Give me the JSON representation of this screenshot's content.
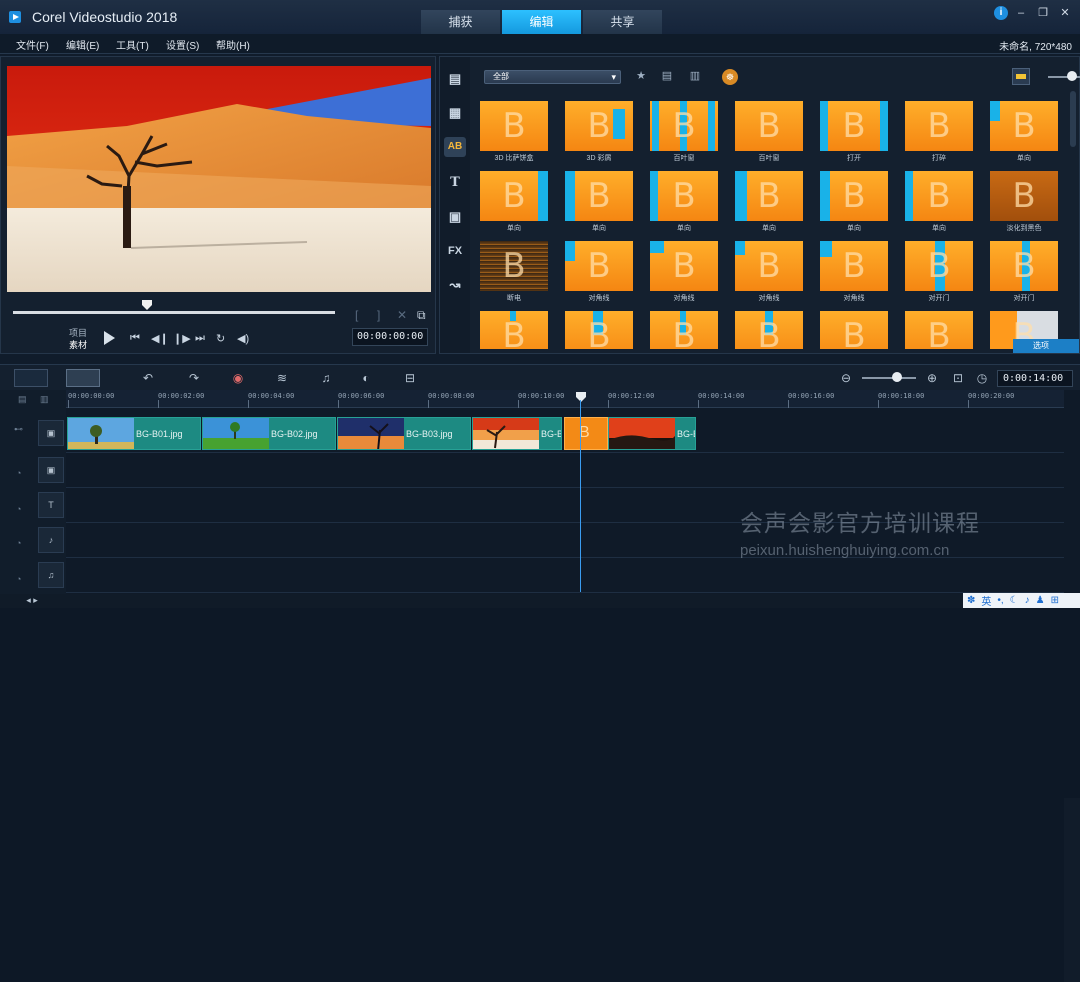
{
  "app": {
    "title": "Corel Videostudio 2018",
    "mode_tabs": [
      "捕获",
      "编辑",
      "共享"
    ],
    "active_mode": "编辑",
    "window_buttons": [
      "i",
      "–",
      "❐",
      "✕"
    ]
  },
  "menu": {
    "items": [
      "文件(F)",
      "编辑(E)",
      "工具(T)",
      "设置(S)",
      "帮助(H)"
    ],
    "project_info": "未命名, 720*480"
  },
  "preview": {
    "mode_labels": [
      "项目",
      "素材"
    ],
    "selected_mode": "素材",
    "timecode": "00:00:00:00",
    "playback_icons": [
      "play-icon",
      "start-icon",
      "prev-frame-icon",
      "next-frame-icon",
      "end-icon",
      "repeat-icon",
      "volume-icon"
    ]
  },
  "library": {
    "categories": [
      "media-icon",
      "instant-project-icon",
      "transition-icon",
      "title-icon",
      "graphic-icon",
      "fx-icon",
      "path-icon"
    ],
    "category_labels": {
      "fx": "FX",
      "title": "T",
      "transition": "AB"
    },
    "active_category": "transition",
    "filter_dropdown": "全部",
    "options_button": "选项",
    "thumbnails": [
      {
        "label": "3D 比萨饼盒"
      },
      {
        "label": "3D 彩屑"
      },
      {
        "label": "百叶窗"
      },
      {
        "label": "百叶窗"
      },
      {
        "label": "打开"
      },
      {
        "label": "打碎"
      },
      {
        "label": "单向"
      },
      {
        "label": "单向"
      },
      {
        "label": "单向"
      },
      {
        "label": "单向"
      },
      {
        "label": "单向"
      },
      {
        "label": "单向"
      },
      {
        "label": "单向"
      },
      {
        "label": "淡化到黑色"
      },
      {
        "label": "断电"
      },
      {
        "label": "对角线"
      },
      {
        "label": "对角线"
      },
      {
        "label": "对角线"
      },
      {
        "label": "对角线"
      },
      {
        "label": "对开门"
      },
      {
        "label": "对开门"
      },
      {
        "label": ""
      },
      {
        "label": ""
      },
      {
        "label": ""
      },
      {
        "label": ""
      },
      {
        "label": ""
      },
      {
        "label": ""
      },
      {
        "label": ""
      }
    ]
  },
  "timeline": {
    "timecode": "0:00:14:00",
    "ruler_labels": [
      "00:00:00:00",
      "00:00:02:00",
      "00:00:04:00",
      "00:00:06:00",
      "00:00:08:00",
      "00:00:10:00",
      "00:00:12:00",
      "00:00:14:00",
      "00:00:16:00",
      "00:00:18:00",
      "00:00:20:00"
    ],
    "clips": [
      {
        "label": "BG-B01.jpg"
      },
      {
        "label": "BG-B02.jpg"
      },
      {
        "label": "BG-B03.jpg"
      },
      {
        "label": "BG-B"
      },
      {
        "label": "BG-B"
      }
    ],
    "tracks": [
      "video-track",
      "overlay-track",
      "title-track",
      "voice-track",
      "music-track"
    ]
  },
  "watermark": {
    "line1": "会声会影官方培训课程",
    "line2": "peixun.huishenghuiying.com.cn"
  },
  "ime_bar": {
    "lang": "英"
  }
}
